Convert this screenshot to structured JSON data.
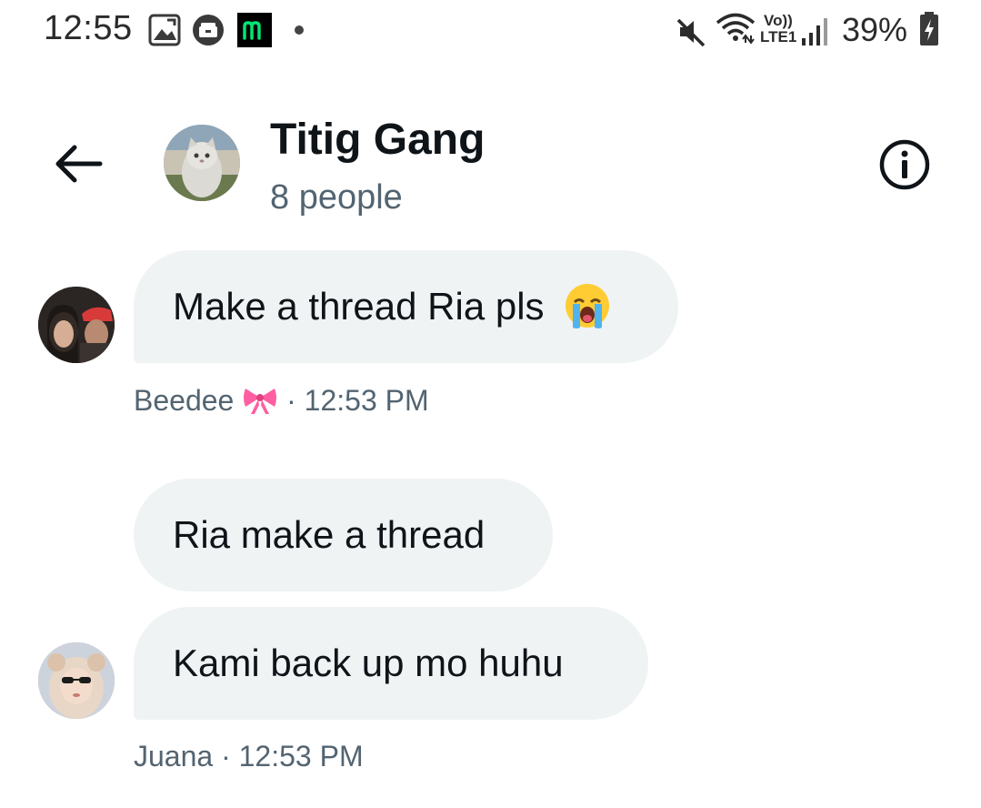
{
  "status_bar": {
    "time": "12:55",
    "battery": "39%",
    "network_label": "LTE1",
    "volte_label": "Vo))",
    "icons": [
      "gallery-icon",
      "storage-icon",
      "m-app-icon",
      "mute-icon",
      "wifi-icon",
      "signal-icon",
      "battery-charging-icon"
    ]
  },
  "header": {
    "title": "Titig Gang",
    "subtitle": "8 people",
    "back_icon": "back-arrow-icon",
    "info_icon": "info-icon"
  },
  "messages": [
    {
      "text": "Make a thread Ria pls",
      "emoji": "loudly-crying-face",
      "sender": "Beedee",
      "sender_emoji": "ribbon",
      "time": "12:53 PM"
    },
    {
      "text": "Ria make a thread"
    },
    {
      "text": "Kami back up mo huhu",
      "sender": "Juana",
      "time": "12:53 PM"
    }
  ],
  "meta_separator": "·",
  "colors": {
    "bubble": "#eff3f4",
    "text_primary": "#0f1419",
    "text_secondary": "#536471",
    "m_app_green": "#00e676"
  }
}
